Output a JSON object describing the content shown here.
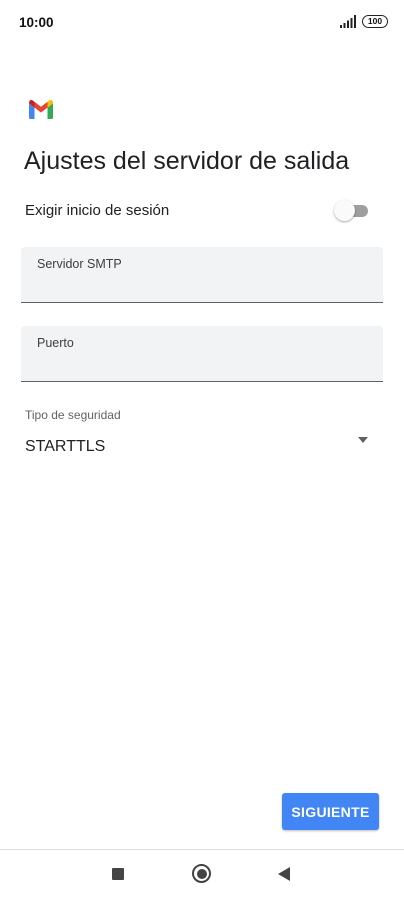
{
  "status_bar": {
    "time": "10:00",
    "battery": "100",
    "signal_icon": "signal-bars-icon",
    "battery_icon": "battery-icon"
  },
  "app": {
    "logo_icon": "gmail-logo-icon",
    "brand_colors": {
      "blue": "#4285F4",
      "red": "#EA4335",
      "yellow": "#FBBC04",
      "green": "#34A853",
      "dark_red": "#C5221F"
    }
  },
  "page": {
    "title": "Ajustes del servidor de salida"
  },
  "require_login": {
    "label": "Exigir inicio de sesión",
    "enabled": false
  },
  "smtp_server": {
    "label": "Servidor SMTP",
    "value": ""
  },
  "port": {
    "label": "Puerto",
    "value": ""
  },
  "security": {
    "label": "Tipo de seguridad",
    "value": "STARTTLS"
  },
  "actions": {
    "next_label": "SIGUIENTE",
    "accent_color": "#4285F4"
  },
  "nav_bar": {
    "recents_icon": "square-icon",
    "home_icon": "circle-icon",
    "back_icon": "triangle-back-icon"
  }
}
